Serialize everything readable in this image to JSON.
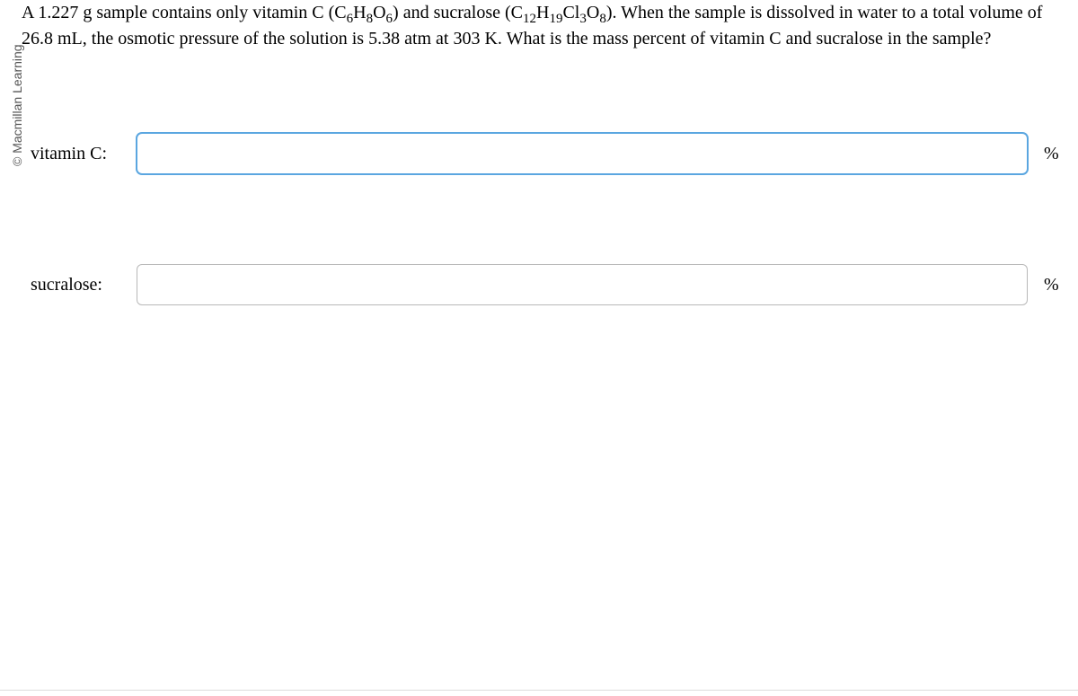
{
  "copyright": "© Macmillan Learning",
  "question": {
    "pre1": "A 1.227 g sample contains only vitamin C (C",
    "s1": "6",
    "mid1": "H",
    "s2": "8",
    "mid2": "O",
    "s3": "6",
    "mid3": ") and sucralose (C",
    "s4": "12",
    "mid4": "H",
    "s5": "19",
    "mid5": "Cl",
    "s6": "3",
    "mid6": "O",
    "s7": "8",
    "post": "). When the sample is dissolved in water to a total volume of 26.8 mL, the osmotic pressure of the solution is 5.38 atm at 303 K. What is the mass percent of vitamin C and sucralose in the sample?"
  },
  "answers": {
    "vitaminC": {
      "label": "vitamin C:",
      "value": "",
      "unit": "%"
    },
    "sucralose": {
      "label": "sucralose:",
      "value": "",
      "unit": "%"
    }
  }
}
